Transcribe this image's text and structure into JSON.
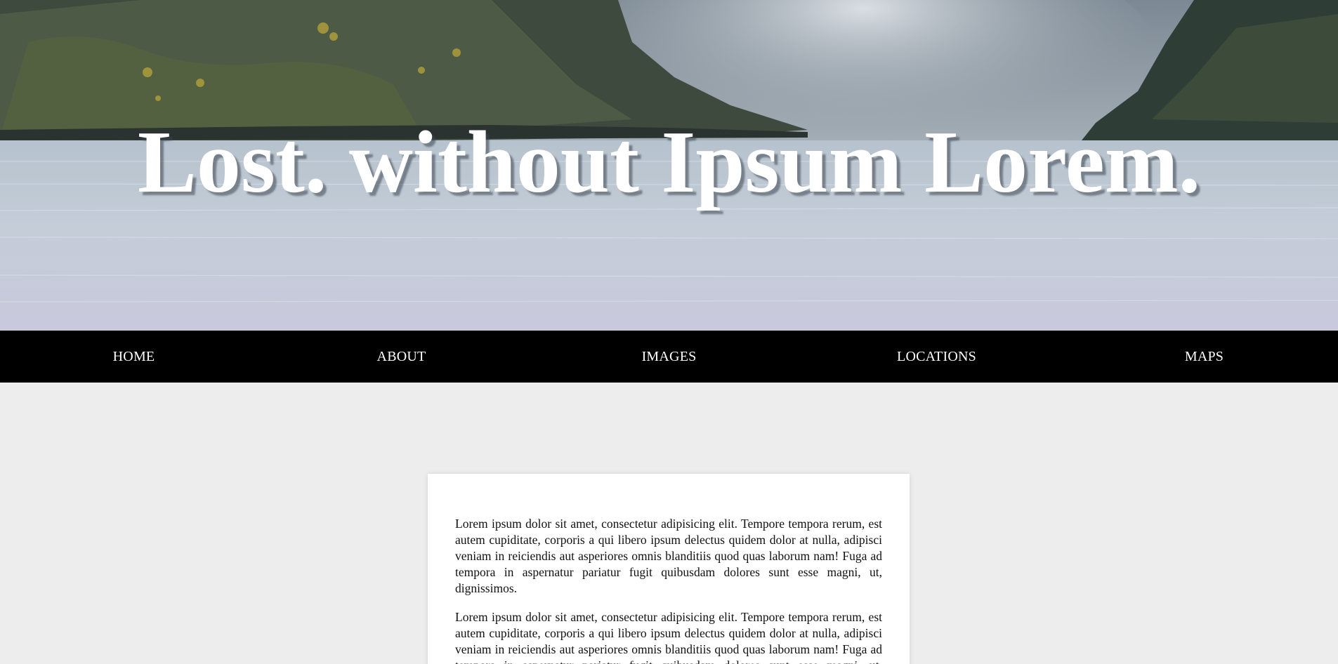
{
  "hero": {
    "title": "Lost. without Ipsum Lorem."
  },
  "nav": {
    "items": [
      {
        "label": "HOME"
      },
      {
        "label": "ABOUT"
      },
      {
        "label": "IMAGES"
      },
      {
        "label": "LOCATIONS"
      },
      {
        "label": "MAPS"
      }
    ]
  },
  "content": {
    "paragraphs": [
      "Lorem ipsum dolor sit amet, consectetur adipisicing elit. Tempore tempora rerum, est autem cupiditate, corporis a qui libero ipsum delectus quidem dolor at nulla, adipisci veniam in reiciendis aut asperiores omnis blanditiis quod quas laborum nam! Fuga ad tempora in aspernatur pariatur fugit quibusdam dolores sunt esse magni, ut, dignissimos.",
      "Lorem ipsum dolor sit amet, consectetur adipisicing elit. Tempore tempora rerum, est autem cupiditate, corporis a qui libero ipsum delectus quidem dolor at nulla, adipisci veniam in reiciendis aut asperiores omnis blanditiis quod quas laborum nam! Fuga ad tempora in aspernatur pariatur fugit quibusdam dolores sunt esse magni, ut, dignissimos."
    ]
  },
  "colors": {
    "nav_background": "#000000",
    "nav_text": "#ffffff",
    "page_background": "#ededed",
    "card_background": "#ffffff"
  }
}
